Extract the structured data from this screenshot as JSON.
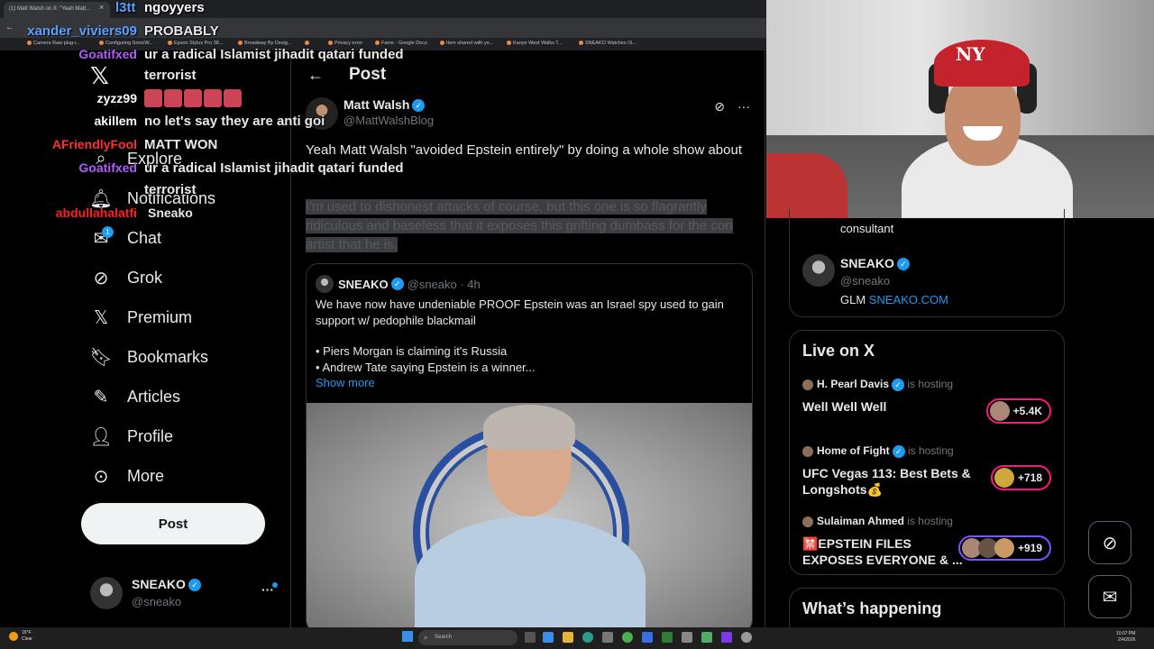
{
  "browser": {
    "tab_title": "(1) Matt Walsh on X: \"Yeah Matt...",
    "tab_close": "×",
    "bookmarks": [
      "Camera Raw plug-i...",
      "Configuring SonicW...",
      "Epson Stylus Pro 38...",
      "Broadway By Desig...",
      "",
      "Privacy error",
      "Fame - Google Docs",
      "Item shared with yo...",
      "Kanye West Walks T...",
      "SNEAKO Watches IS..."
    ]
  },
  "sidebar": {
    "items": [
      {
        "label": "Explore",
        "icon": "search-icon"
      },
      {
        "label": "Notifications",
        "icon": "bell-icon"
      },
      {
        "label": "Chat",
        "icon": "mail-icon",
        "badge": "1"
      },
      {
        "label": "Grok",
        "icon": "grok-icon"
      },
      {
        "label": "Premium",
        "icon": "x-logo-icon"
      },
      {
        "label": "Bookmarks",
        "icon": "bookmark-icon"
      },
      {
        "label": "Articles",
        "icon": "article-icon"
      },
      {
        "label": "Profile",
        "icon": "person-icon"
      },
      {
        "label": "More",
        "icon": "more-icon"
      }
    ],
    "post_button": "Post",
    "account": {
      "name": "SNEAKO",
      "handle": "@sneako",
      "menu": "···"
    }
  },
  "post": {
    "header_title": "Post",
    "author_name": "Matt Walsh",
    "author_handle": "@MattWalshBlog",
    "text": "Yeah Matt Walsh \"avoided Epstein entirely\" by doing a whole show about",
    "selected_text_1": "I'm used to dishonest attacks of course, but this one is  so flagrantly",
    "selected_text_2": "ridiculous and baseless that it exposes this grifting dumbass for the con",
    "selected_text_3": "artist that he is.",
    "quote": {
      "name": "SNEAKO",
      "handle": "@sneako · 4h",
      "body": "We have now have undeniable PROOF Epstein was an Israel spy used to gain support w/ pedophile blackmail",
      "list_1": "• Piers Morgan is claiming it's Russia",
      "list_2": "• Andrew Tate saying Epstein is a winner...",
      "show_more": "Show more"
    }
  },
  "chat_overlay": [
    {
      "user": "xander_viviers09",
      "msg": "PROBABLY",
      "color": "#5aa0ff"
    },
    {
      "user": "Goatifxed",
      "msg": "ur a radical Islamist jihadit qatari funded",
      "color": "#b05cff"
    },
    {
      "user": "",
      "msg": "terrorist",
      "color": ""
    },
    {
      "user": "zyzz99",
      "msg": "",
      "color": "#ffffff"
    },
    {
      "user": "akillem",
      "msg": "no let's say they are anti goi",
      "color": "#ffffff"
    },
    {
      "user": "AFriendlyFool",
      "msg": "MATT WON",
      "color": "#ff3030"
    },
    {
      "user": "Goatifxed",
      "msg": "ur a radical Islamist jihadit qatari funded",
      "color": "#b05cff"
    },
    {
      "user": "",
      "msg": "terrorist",
      "color": ""
    },
    {
      "user": "abdullahalatfi",
      "msg": "Sneako",
      "color": "#ff2020"
    }
  ],
  "top_overlay": {
    "user": "l3tt",
    "msg": "ngoyyers"
  },
  "right": {
    "consultant_text": "consultant",
    "profile_name": "SNEAKO",
    "profile_handle": "@sneako",
    "profile_bio_prefix": "GLM",
    "profile_bio_link": "SNEAKO.COM",
    "live_title": "Live on X",
    "live": [
      {
        "host": "H. Pearl Davis",
        "suffix": "is hosting",
        "title": "Well Well Well",
        "count": "+5.4K"
      },
      {
        "host": "Home of Fight",
        "suffix": "is hosting",
        "title": "UFC Vegas 113: Best Bets & Longshots💰",
        "count": "+718"
      },
      {
        "host": "Sulaiman Ahmed",
        "suffix": "is hosting",
        "title": "🈲EPSTEIN FILES EXPOSES EVERYONE & ...",
        "count": "+919"
      }
    ],
    "whats_happening": "What’s happening"
  },
  "taskbar": {
    "weather_temp": "16°F",
    "weather_desc": "Clear",
    "search": "Search",
    "time": "10:07 PM",
    "date": "2/4/2026"
  }
}
